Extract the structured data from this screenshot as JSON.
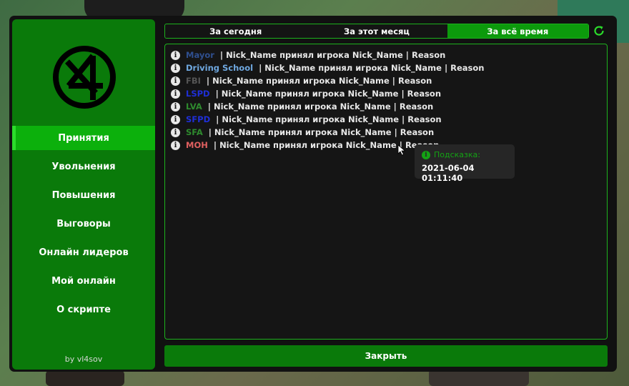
{
  "sidebar": {
    "items": [
      {
        "label": "Принятия",
        "active": true
      },
      {
        "label": "Увольнения",
        "active": false
      },
      {
        "label": "Повышения",
        "active": false
      },
      {
        "label": "Выговоры",
        "active": false
      },
      {
        "label": "Онлайн лидеров",
        "active": false
      },
      {
        "label": "Мой онлайн",
        "active": false
      },
      {
        "label": "О скрипте",
        "active": false
      }
    ],
    "author": "by vl4sov"
  },
  "tabs": [
    {
      "label": "За сегодня",
      "active": false
    },
    {
      "label": "За этот месяц",
      "active": false
    },
    {
      "label": "За всё время",
      "active": true
    }
  ],
  "log": {
    "separator": "|",
    "entries": [
      {
        "org": "Mayor",
        "org_color": "#2f4f8f",
        "text": "Nick_Name принял игрока Nick_Name",
        "reason": "Reason"
      },
      {
        "org": "Driving School",
        "org_color": "#6fa8e0",
        "text": "Nick_Name принял игрока Nick_Name",
        "reason": "Reason"
      },
      {
        "org": "FBI",
        "org_color": "#555555",
        "text": "Nick_Name принял игрока Nick_Name",
        "reason": "Reason"
      },
      {
        "org": "LSPD",
        "org_color": "#1f2fd6",
        "text": "Nick_Name принял игрока Nick_Name",
        "reason": "Reason"
      },
      {
        "org": "LVA",
        "org_color": "#2e8b2e",
        "text": "Nick_Name принял игрока Nick_Name",
        "reason": "Reason"
      },
      {
        "org": "SFPD",
        "org_color": "#1f2fd6",
        "text": "Nick_Name принял игрока Nick_Name",
        "reason": "Reason"
      },
      {
        "org": "SFA",
        "org_color": "#2e8b2e",
        "text": "Nick_Name принял игрока Nick_Name",
        "reason": "Reason"
      },
      {
        "org": "MOH",
        "org_color": "#e06060",
        "text": "Nick_Name принял игрока Nick_Name",
        "reason": "Reason"
      }
    ]
  },
  "tooltip": {
    "title": "Подсказка:",
    "value": "2021-06-04 01:11:40"
  },
  "close_label": "Закрыть",
  "colors": {
    "accent": "#0a7a0a",
    "accent_active": "#0cb00c",
    "border": "#1db21d"
  }
}
